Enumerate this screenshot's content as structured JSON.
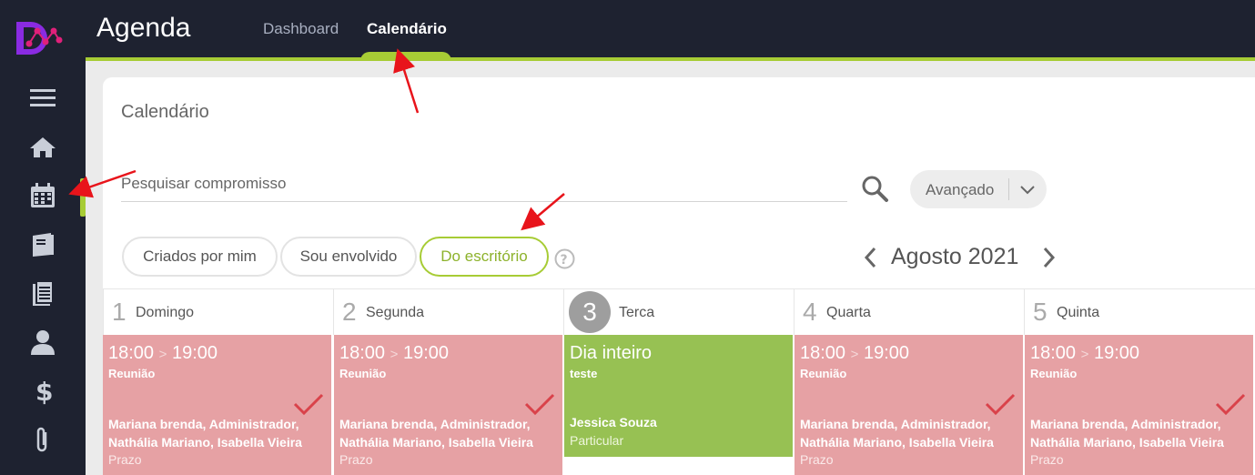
{
  "app": {
    "title": "Agenda"
  },
  "nav": {
    "tabs": [
      {
        "label": "Dashboard"
      },
      {
        "label": "Calendário"
      }
    ]
  },
  "sidebar": {
    "icons": [
      "menu-icon",
      "home-icon",
      "calendar-icon",
      "notebook-icon",
      "document-icon",
      "user-icon",
      "dollar-icon",
      "paperclip-icon"
    ]
  },
  "page": {
    "title": "Calendário"
  },
  "search": {
    "placeholder": "Pesquisar compromisso",
    "advanced_label": "Avançado"
  },
  "filters": [
    {
      "label": "Criados por mim"
    },
    {
      "label": "Sou envolvido"
    },
    {
      "label": "Do escritório"
    }
  ],
  "month": {
    "label": "Agosto 2021"
  },
  "days": [
    {
      "num": "1",
      "name": "Domingo"
    },
    {
      "num": "2",
      "name": "Segunda"
    },
    {
      "num": "3",
      "name": "Terca"
    },
    {
      "num": "4",
      "name": "Quarta"
    },
    {
      "num": "5",
      "name": "Quinta"
    }
  ],
  "events": [
    {
      "start": "18:00",
      "end": "19:00",
      "title": "Reunião",
      "people": "Mariana brenda, Administrador, Nathália Mariano, Isabella Vieira",
      "type": "Prazo"
    },
    {
      "start": "18:00",
      "end": "19:00",
      "title": "Reunião",
      "people": "Mariana brenda, Administrador, Nathália Mariano, Isabella Vieira",
      "type": "Prazo"
    },
    {
      "time": "Dia inteiro",
      "title": "teste",
      "person": "Jessica Souza",
      "type": "Particular"
    },
    {
      "start": "18:00",
      "end": "19:00",
      "title": "Reunião",
      "people": "Mariana brenda, Administrador, Nathália Mariano, Isabella Vieira",
      "type": "Prazo"
    },
    {
      "start": "18:00",
      "end": "19:00",
      "title": "Reunião",
      "people": "Mariana brenda, Administrador, Nathália Mariano, Isabella Vieira",
      "type": "Prazo"
    }
  ],
  "colors": {
    "accent": "#a7cc35",
    "sidebar": "#1e2230",
    "event_red": "#e6a1a4",
    "event_green": "#97c153",
    "check": "#d9424a",
    "arrow": "#e8141b"
  }
}
